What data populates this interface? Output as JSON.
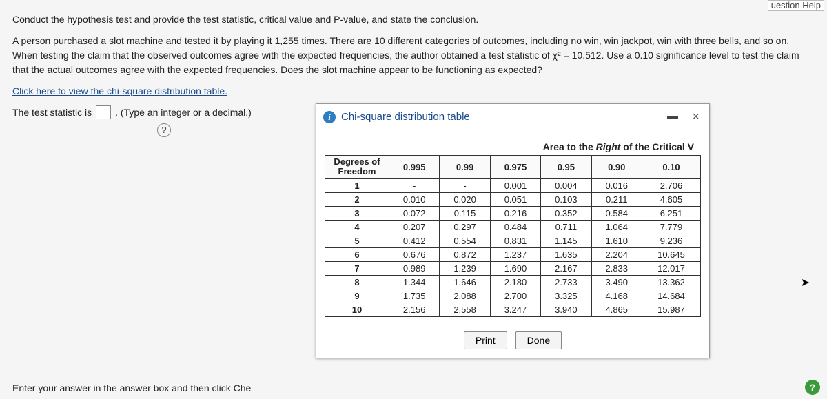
{
  "top_fragment": "uestion Help",
  "question": {
    "line1": "Conduct the hypothesis test and provide the test statistic, critical value and P-value, and state the conclusion.",
    "body": "A person purchased a slot machine and tested it by playing it 1,255 times. There are 10 different categories of outcomes, including no win, win jackpot, win with three bells, and so on. When testing the claim that the observed outcomes agree with the expected frequencies, the author obtained a test statistic of χ² = 10.512. Use a 0.10 significance level to test the claim that the actual outcomes agree with the expected frequencies. Does the slot machine appear to be functioning as expected?",
    "link": "Click here to view the chi-square distribution table."
  },
  "answer_row": {
    "prefix": "The test statistic is",
    "suffix": ". (Type an integer or a decimal.)",
    "hint_char": "?"
  },
  "footer_text": "Enter your answer in the answer box and then click Che",
  "help_corner": "?",
  "popup": {
    "title": "Chi-square distribution table",
    "info_char": "i",
    "close_char": "×",
    "caption_a": "Area to the ",
    "caption_b_italic": "Right",
    "caption_c": " of the Critical V",
    "df_header_a": "Degrees of",
    "df_header_b": "Freedom",
    "buttons": {
      "print": "Print",
      "done": "Done"
    }
  },
  "chart_data": {
    "type": "table",
    "title": "Chi-square distribution table — Area to the Right of the Critical Value",
    "columns": [
      "0.995",
      "0.99",
      "0.975",
      "0.95",
      "0.90",
      "0.10"
    ],
    "rows": [
      {
        "df": "1",
        "cells": [
          "-",
          "-",
          "0.001",
          "0.004",
          "0.016",
          "2.706"
        ]
      },
      {
        "df": "2",
        "cells": [
          "0.010",
          "0.020",
          "0.051",
          "0.103",
          "0.211",
          "4.605"
        ]
      },
      {
        "df": "3",
        "cells": [
          "0.072",
          "0.115",
          "0.216",
          "0.352",
          "0.584",
          "6.251"
        ]
      },
      {
        "df": "4",
        "cells": [
          "0.207",
          "0.297",
          "0.484",
          "0.711",
          "1.064",
          "7.779"
        ]
      },
      {
        "df": "5",
        "cells": [
          "0.412",
          "0.554",
          "0.831",
          "1.145",
          "1.610",
          "9.236"
        ]
      },
      {
        "df": "6",
        "cells": [
          "0.676",
          "0.872",
          "1.237",
          "1.635",
          "2.204",
          "10.645"
        ]
      },
      {
        "df": "7",
        "cells": [
          "0.989",
          "1.239",
          "1.690",
          "2.167",
          "2.833",
          "12.017"
        ]
      },
      {
        "df": "8",
        "cells": [
          "1.344",
          "1.646",
          "2.180",
          "2.733",
          "3.490",
          "13.362"
        ]
      },
      {
        "df": "9",
        "cells": [
          "1.735",
          "2.088",
          "2.700",
          "3.325",
          "4.168",
          "14.684"
        ]
      },
      {
        "df": "10",
        "cells": [
          "2.156",
          "2.558",
          "3.247",
          "3.940",
          "4.865",
          "15.987"
        ]
      }
    ]
  }
}
